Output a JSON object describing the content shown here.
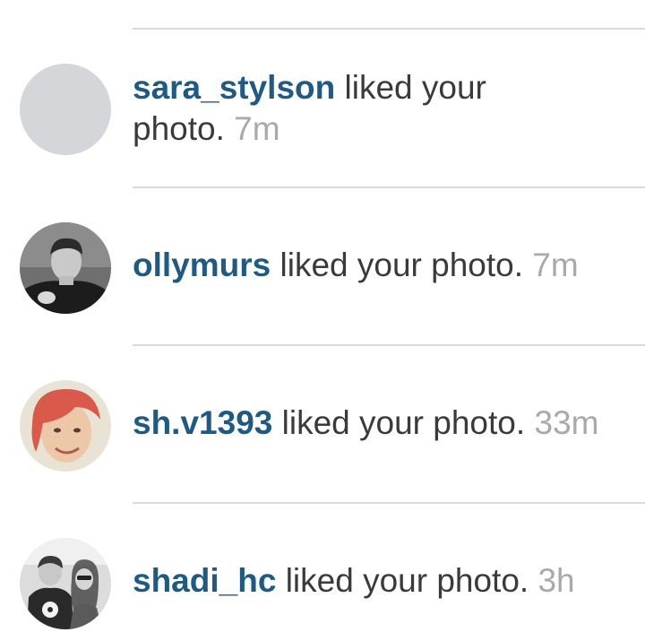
{
  "notifications": [
    {
      "username": "sara_stylson",
      "action": "liked your photo.",
      "time": "7m",
      "avatar_icon": "blank-avatar"
    },
    {
      "username": "ollymurs",
      "action": "liked your photo.",
      "time": "7m",
      "avatar_icon": "profile-photo"
    },
    {
      "username": "sh.v1393",
      "action": "liked your photo.",
      "time": "33m",
      "avatar_icon": "profile-photo"
    },
    {
      "username": "shadi_hc",
      "action": "liked your photo.",
      "time": "3h",
      "avatar_icon": "profile-photo"
    }
  ],
  "colors": {
    "username": "#1f5a85",
    "text": "#3a3a3a",
    "time": "#a9a9a9",
    "divider": "#d9d9d9",
    "blank_avatar": "#d4d6da"
  }
}
